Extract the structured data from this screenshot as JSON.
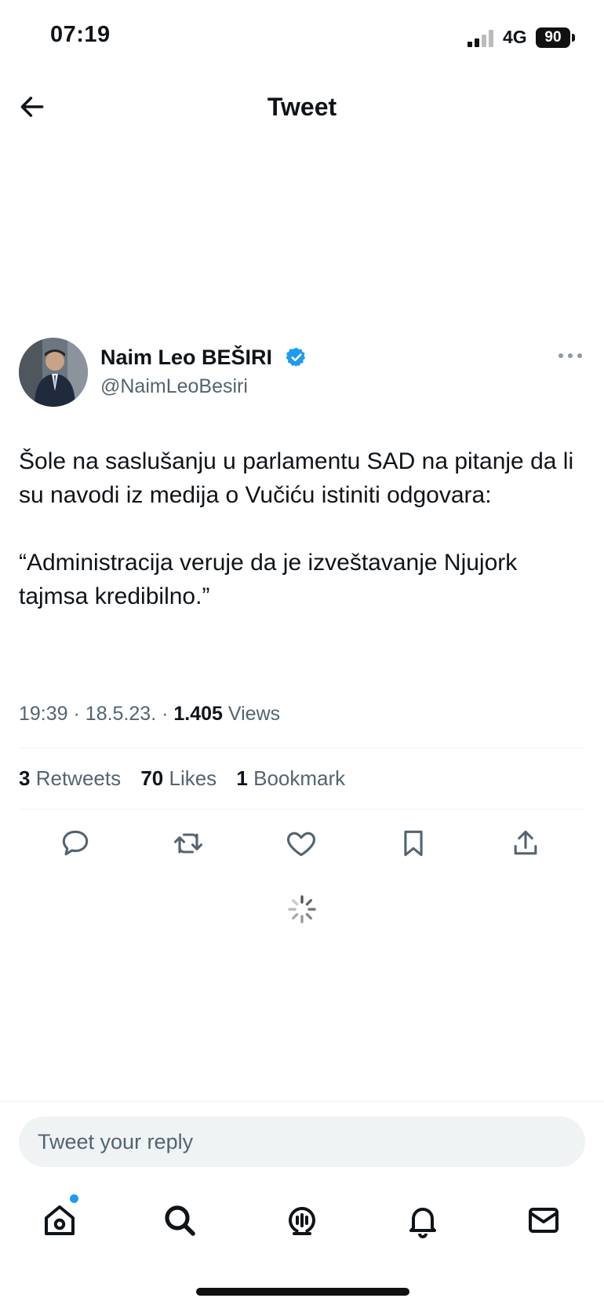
{
  "status_bar": {
    "time": "07:19",
    "network": "4G",
    "battery": "90"
  },
  "header": {
    "title": "Tweet",
    "back_icon": "arrow-left-icon"
  },
  "tweet": {
    "author_name": "Naim Leo BEŠIRI",
    "verified": true,
    "handle": "@NaimLeoBesiri",
    "text": "Šole na saslušanju u parlamentu SAD na pitanje da li su navodi iz medija o Vučiću istiniti odgovara:\n\n“Administracija veruje da je izveštavanje Njujork tajmsa kredibilno.”",
    "time": "19:39",
    "date": "18.5.23.",
    "views_count": "1.405",
    "views_label": "Views",
    "retweets_count": "3",
    "retweets_label": "Retweets",
    "likes_count": "70",
    "likes_label": "Likes",
    "bookmarks_count": "1",
    "bookmarks_label": "Bookmark"
  },
  "actions": [
    "reply-icon",
    "retweet-icon",
    "like-icon",
    "bookmark-icon",
    "share-icon"
  ],
  "reply": {
    "placeholder": "Tweet your reply"
  },
  "bottom_nav": [
    "home-icon",
    "search-icon",
    "spaces-icon",
    "notifications-icon",
    "messages-icon"
  ],
  "colors": {
    "accent": "#1d9bf0",
    "text": "#0f1419",
    "muted": "#536471"
  }
}
